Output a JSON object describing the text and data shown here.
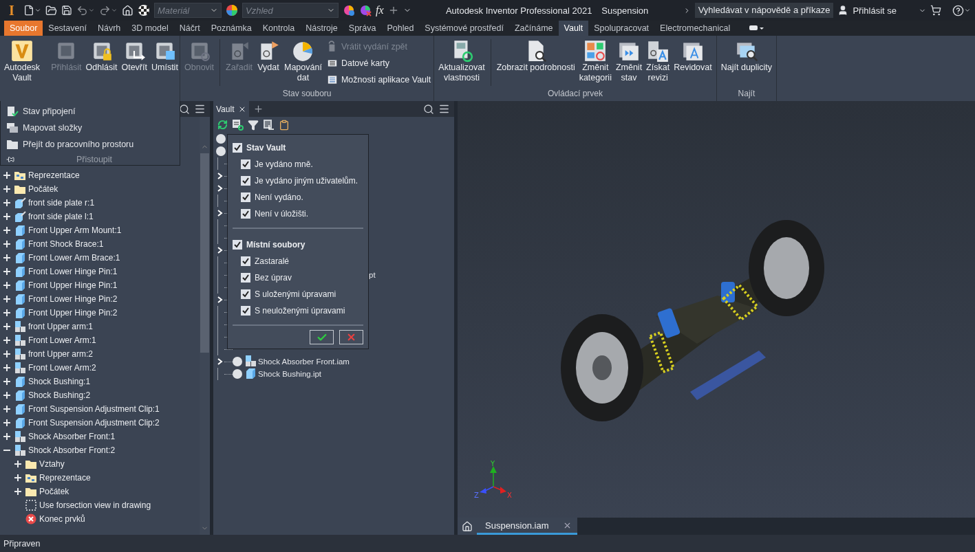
{
  "title_bar": {
    "logo": "I",
    "material_placeholder": "Materiál",
    "appearance_placeholder": "Vzhled",
    "fx": "fx",
    "app_title": "Autodesk Inventor Professional 2021",
    "document": "Suspension",
    "search": "Vyhledávat v nápovědě a příkaze",
    "sign_in": "Přihlásit se"
  },
  "tabs": [
    {
      "label": "Soubor",
      "kind": "file",
      "selected": false
    },
    {
      "label": "Sestavení",
      "kind": "tab",
      "selected": false
    },
    {
      "label": "Návrh",
      "kind": "tab",
      "selected": false
    },
    {
      "label": "3D model",
      "kind": "tab",
      "selected": false
    },
    {
      "label": "Náčrt",
      "kind": "tab",
      "selected": false
    },
    {
      "label": "Poznámka",
      "kind": "tab",
      "selected": false
    },
    {
      "label": "Kontrola",
      "kind": "tab",
      "selected": false
    },
    {
      "label": "Nástroje",
      "kind": "tab",
      "selected": false
    },
    {
      "label": "Správa",
      "kind": "tab",
      "selected": false
    },
    {
      "label": "Pohled",
      "kind": "tab",
      "selected": false
    },
    {
      "label": "Systémové prostředí",
      "kind": "tab",
      "selected": false
    },
    {
      "label": "Začínáme",
      "kind": "tab",
      "selected": false
    },
    {
      "label": "Vault",
      "kind": "tab",
      "selected": true
    },
    {
      "label": "Spolupracovat",
      "kind": "tab",
      "selected": false
    },
    {
      "label": "Electromechanical",
      "kind": "tab",
      "selected": false
    }
  ],
  "ribbon": {
    "panels": [
      {
        "items": [
          {
            "kind": "large",
            "label": "Autodesk\nVault",
            "disabled": false
          },
          {
            "kind": "separator"
          },
          {
            "kind": "large",
            "label": "Přihlásit",
            "disabled": true
          },
          {
            "kind": "large",
            "label": "Odhlásit",
            "disabled": false
          },
          {
            "kind": "large",
            "label": "Otevřít",
            "disabled": false
          },
          {
            "kind": "large",
            "label": "Umístit",
            "disabled": false
          }
        ]
      },
      {
        "title": "Stav souboru",
        "items": [
          {
            "kind": "large",
            "label": "Obnovit",
            "disabled": true
          },
          {
            "kind": "separator"
          },
          {
            "kind": "large",
            "label": "Zařadit",
            "disabled": true
          },
          {
            "kind": "large",
            "label": "Vydat",
            "disabled": false
          },
          {
            "kind": "large",
            "label": "Mapování\ndat",
            "disabled": false
          },
          {
            "kind": "stack",
            "items": [
              {
                "label": "Vrátit vydání zpět",
                "disabled": true
              },
              {
                "label": "Datové karty",
                "disabled": false
              },
              {
                "label": "Možnosti aplikace Vault",
                "disabled": false
              }
            ]
          }
        ]
      },
      {
        "title": "Ovládací prvek",
        "items": [
          {
            "kind": "large",
            "label": "Aktualizovat\nvlastnosti",
            "disabled": false
          },
          {
            "kind": "separator"
          },
          {
            "kind": "large",
            "label": "Zobrazit podrobnosti",
            "disabled": false
          },
          {
            "kind": "large",
            "label": "Změnit\nkategorii",
            "disabled": false
          },
          {
            "kind": "large",
            "label": "Změnit\nstav",
            "disabled": false
          },
          {
            "kind": "large",
            "label": "Získat\nrevizi",
            "disabled": false
          },
          {
            "kind": "large",
            "label": "Revidovat",
            "disabled": false
          }
        ]
      },
      {
        "title": "Najít",
        "items": [
          {
            "kind": "large",
            "label": "Najít duplicity",
            "disabled": false
          }
        ]
      }
    ]
  },
  "access_menu": {
    "items": [
      {
        "label": "Stav připojení"
      },
      {
        "label": "Mapovat složky"
      },
      {
        "label": "Přejít do pracovního prostoru"
      }
    ],
    "title": "Přistoupit"
  },
  "browser": {
    "items": [
      {
        "label": "Reprezentace",
        "kind": "folder-tree",
        "expanded": false
      },
      {
        "label": "Počátek",
        "kind": "folder",
        "expanded": false
      },
      {
        "label": "front side plate r:1",
        "kind": "part-pin",
        "expanded": false
      },
      {
        "label": "front side plate l:1",
        "kind": "part-pin",
        "expanded": false
      },
      {
        "label": "Front Upper Arm Mount:1",
        "kind": "part",
        "expanded": false
      },
      {
        "label": "Front Shock Brace:1",
        "kind": "part",
        "expanded": false
      },
      {
        "label": "Front Lower Arm Brace:1",
        "kind": "part",
        "expanded": false
      },
      {
        "label": "Front Lower Hinge Pin:1",
        "kind": "part",
        "expanded": false
      },
      {
        "label": "Front Upper Hinge Pin:1",
        "kind": "part",
        "expanded": false
      },
      {
        "label": "Front Lower Hinge Pin:2",
        "kind": "part",
        "expanded": false
      },
      {
        "label": "Front Upper Hinge Pin:2",
        "kind": "part",
        "expanded": false
      },
      {
        "label": "front Upper arm:1",
        "kind": "assembly",
        "expanded": false
      },
      {
        "label": "Front Lower Arm:1",
        "kind": "assembly",
        "expanded": false
      },
      {
        "label": "front Upper arm:2",
        "kind": "assembly",
        "expanded": false
      },
      {
        "label": "Front Lower Arm:2",
        "kind": "assembly",
        "expanded": false
      },
      {
        "label": "Shock Bushing:1",
        "kind": "part",
        "expanded": false
      },
      {
        "label": "Shock Bushing:2",
        "kind": "part",
        "expanded": false
      },
      {
        "label": "Front Suspension Adjustment Clip:1",
        "kind": "part",
        "expanded": false
      },
      {
        "label": "Front Suspension Adjustment Clip:2",
        "kind": "part",
        "expanded": false
      },
      {
        "label": "Shock Absorber Front:1",
        "kind": "assembly",
        "expanded": false
      },
      {
        "label": "Shock Absorber Front:2",
        "kind": "assembly",
        "expanded": true,
        "children": [
          {
            "label": "Vztahy",
            "kind": "folder",
            "expanded": false
          },
          {
            "label": "Reprezentace",
            "kind": "folder-tree",
            "expanded": false
          },
          {
            "label": "Počátek",
            "kind": "folder",
            "expanded": false
          },
          {
            "label": "Use forsection view in drawing",
            "kind": "sketch"
          },
          {
            "label": "Konec prvků",
            "kind": "error"
          }
        ]
      }
    ]
  },
  "vault_panel": {
    "tab": "Vault",
    "rows": [
      {
        "kind": "root"
      },
      {
        "kind": "root"
      },
      {
        "kind": "node",
        "has_children": false
      },
      {
        "kind": "node",
        "has_children": true
      },
      {
        "kind": "node",
        "has_children": true
      },
      {
        "kind": "node",
        "has_children": false
      },
      {
        "kind": "node",
        "has_children": true
      },
      {
        "kind": "node",
        "has_children": false
      },
      {
        "kind": "node",
        "has_children": false
      },
      {
        "kind": "node",
        "has_children": true
      },
      {
        "kind": "node",
        "has_children": false
      },
      {
        "kind": "node",
        "has_children": false,
        "label": "pt"
      },
      {
        "kind": "node",
        "has_children": false
      },
      {
        "kind": "node",
        "has_children": true
      },
      {
        "kind": "node",
        "has_children": false
      },
      {
        "kind": "node",
        "has_children": false
      },
      {
        "kind": "node",
        "has_children": false
      },
      {
        "kind": "node",
        "has_children": false
      },
      {
        "kind": "assembly",
        "has_children": true,
        "label": "Shock Absorber Front.iam"
      },
      {
        "kind": "part",
        "has_children": false,
        "label": "Shock Bushing.ipt"
      }
    ],
    "filter": {
      "groups": [
        {
          "label": "Stav Vault",
          "checked": true,
          "options": [
            {
              "label": "Je vydáno mně.",
              "checked": true
            },
            {
              "label": "Je vydáno jiným uživatelům.",
              "checked": true
            },
            {
              "label": "Není vydáno.",
              "checked": true
            },
            {
              "label": "Není v úložišti.",
              "checked": true
            }
          ]
        },
        {
          "label": "Místní soubory",
          "checked": true,
          "options": [
            {
              "label": "Zastaralé",
              "checked": true
            },
            {
              "label": "Bez úprav",
              "checked": true
            },
            {
              "label": "S uloženými úpravami",
              "checked": true
            },
            {
              "label": "S neuloženými úpravami",
              "checked": true
            }
          ]
        }
      ]
    }
  },
  "viewport": {
    "triad": {
      "x": "X",
      "y": "Y",
      "z": "Z"
    },
    "doc_tabs": [
      {
        "label": "Suspension.iam",
        "selected": true
      }
    ]
  },
  "status_bar": "Připraven"
}
